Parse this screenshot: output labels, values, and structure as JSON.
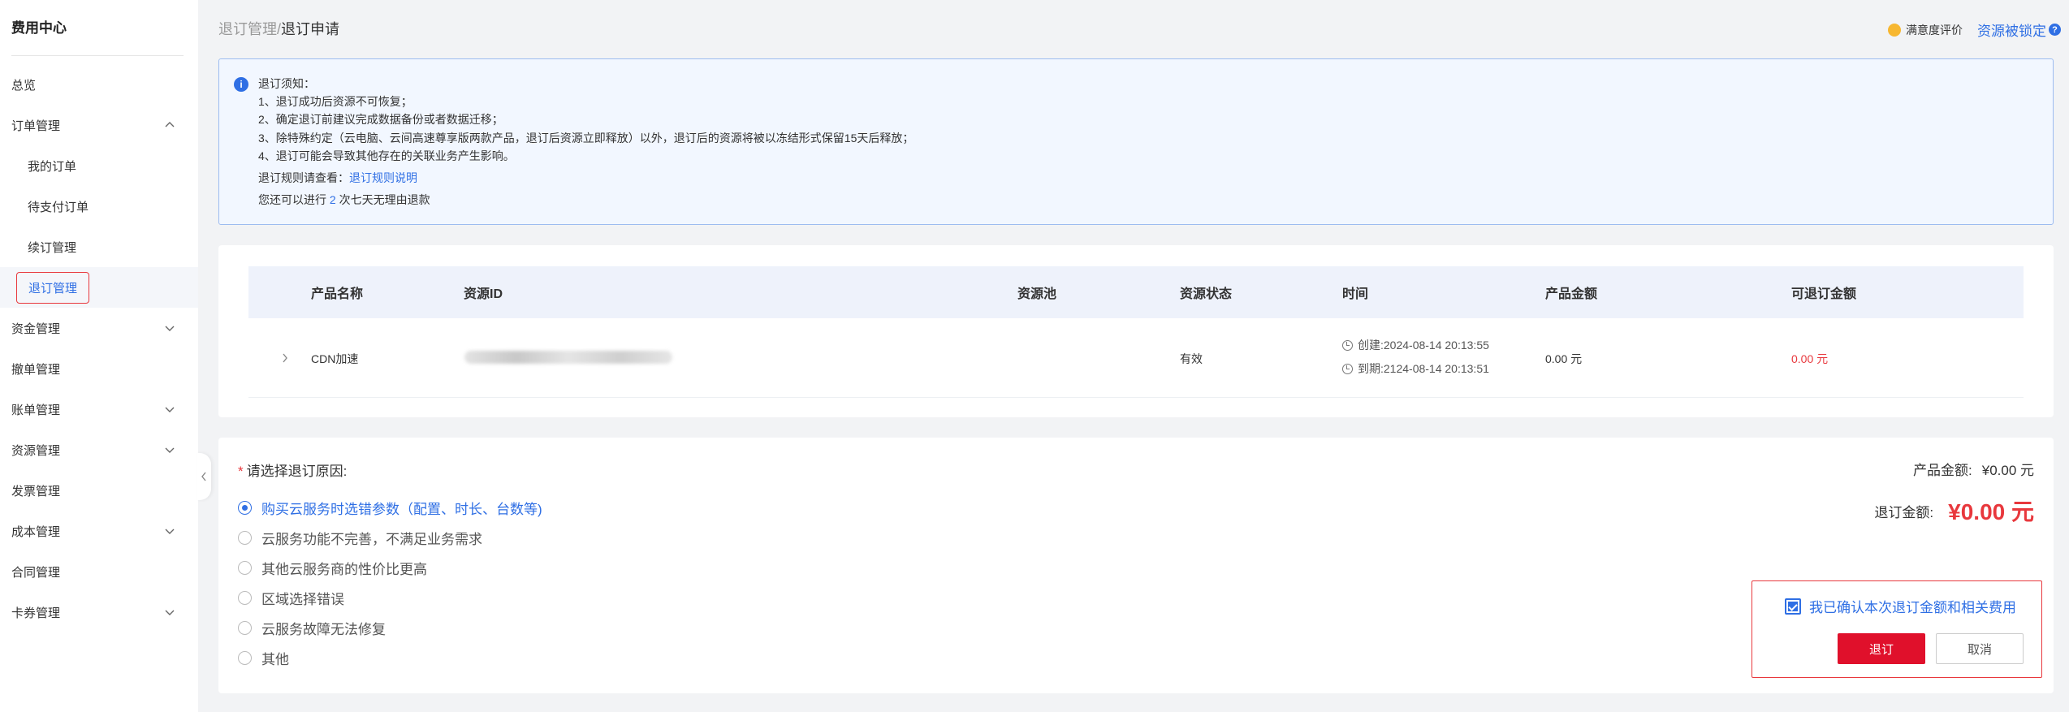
{
  "sidebar": {
    "title": "费用中心",
    "items": [
      {
        "label": "总览"
      },
      {
        "label": "订单管理"
      },
      {
        "label": "我的订单"
      },
      {
        "label": "待支付订单"
      },
      {
        "label": "续订管理"
      },
      {
        "label": "退订管理"
      },
      {
        "label": "资金管理"
      },
      {
        "label": "撤单管理"
      },
      {
        "label": "账单管理"
      },
      {
        "label": "资源管理"
      },
      {
        "label": "发票管理"
      },
      {
        "label": "成本管理"
      },
      {
        "label": "合同管理"
      },
      {
        "label": "卡券管理"
      }
    ]
  },
  "header": {
    "breadcrumb_parent": "退订管理",
    "breadcrumb_sep": "/",
    "breadcrumb_current": "退订申请",
    "satisfaction": "满意度评价",
    "resource_locked": "资源被锁定",
    "help": "?"
  },
  "notice": {
    "icon": "i",
    "title": "退订须知：",
    "lines": [
      "1、退订成功后资源不可恢复；",
      "2、确定退订前建议完成数据备份或者数据迁移；",
      "3、除特殊约定（云电脑、云间高速尊享版两款产品，退订后资源立即释放）以外，退订后的资源将被以冻结形式保留15天后释放；",
      "4、退订可能会导致其他存在的关联业务产生影响。"
    ],
    "rule_prefix": "退订规则请查看：",
    "rule_link": "退订规则说明",
    "refund_prefix": "您还可以进行 ",
    "refund_count": "2",
    "refund_suffix": " 次七天无理由退款"
  },
  "table": {
    "headers": [
      "产品名称",
      "资源ID",
      "资源池",
      "资源状态",
      "时间",
      "产品金额",
      "可退订金额"
    ],
    "rows": [
      {
        "product": "CDN加速",
        "resource_pool": "",
        "status": "有效",
        "created": "创建:2024-08-14 20:13:55",
        "expires": "到期:2124-08-14 20:13:51",
        "amount": "0.00 元",
        "refundable": "0.00 元"
      }
    ]
  },
  "reason": {
    "title": "请选择退订原因:",
    "required_mark": "*",
    "options": [
      "购买云服务时选错参数（配置、时长、台数等)",
      "云服务功能不完善，不满足业务需求",
      "其他云服务商的性价比更高",
      "区域选择错误",
      "云服务故障无法修复",
      "其他"
    ],
    "selected_index": 0
  },
  "summary": {
    "product_amount_label": "产品金额:",
    "product_amount_value": "¥0.00 元",
    "refund_amount_label": "退订金额:",
    "refund_amount_value": "¥0.00 元"
  },
  "confirm": {
    "checkbox_label": "我已确认本次退订金额和相关费用",
    "checked": true,
    "submit": "退订",
    "cancel": "取消"
  },
  "colors": {
    "accent": "#2f6fe4",
    "danger": "#e8383d",
    "primary_button": "#e0102b"
  }
}
